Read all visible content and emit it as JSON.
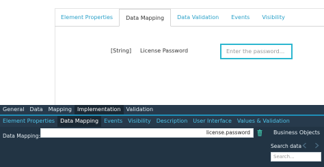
{
  "designer": {
    "tabs": [
      {
        "label": "Element Properties",
        "active": false
      },
      {
        "label": "Data Mapping",
        "active": true
      },
      {
        "label": "Data Validation",
        "active": false
      },
      {
        "label": "Events",
        "active": false
      },
      {
        "label": "Visibility",
        "active": false
      }
    ],
    "row": {
      "type": "[String]",
      "label": "License Password",
      "placeholder": "Enter the password..."
    }
  },
  "panel": {
    "tabs_primary": [
      {
        "label": "General",
        "active": false
      },
      {
        "label": "Data",
        "active": false
      },
      {
        "label": "Mapping",
        "active": false
      },
      {
        "label": "Implementation",
        "active": true
      },
      {
        "label": "Validation",
        "active": false
      }
    ],
    "tabs_secondary": [
      {
        "label": "Element Properties",
        "active": false
      },
      {
        "label": "Data Mapping",
        "active": true
      },
      {
        "label": "Events",
        "active": false
      },
      {
        "label": "Visibility",
        "active": false
      },
      {
        "label": "Description",
        "active": false
      },
      {
        "label": "User Interface",
        "active": false
      },
      {
        "label": "Values & Validation",
        "active": false
      }
    ],
    "data_mapping_label": "Data Mapping:",
    "data_mapping_value": "license.password",
    "business_objects_title": "Business Objects",
    "search_data_label": "Search data",
    "search_placeholder": "Search...",
    "icons": {
      "delete": "trash-icon",
      "prev": "arrow-left-icon",
      "next": "arrow-right-icon"
    }
  },
  "colors": {
    "accent": "#2bb6cf",
    "panel_bg": "#273a4c",
    "panel_tab_active": "#1a2834",
    "trash_icon": "#3fc0a8"
  }
}
